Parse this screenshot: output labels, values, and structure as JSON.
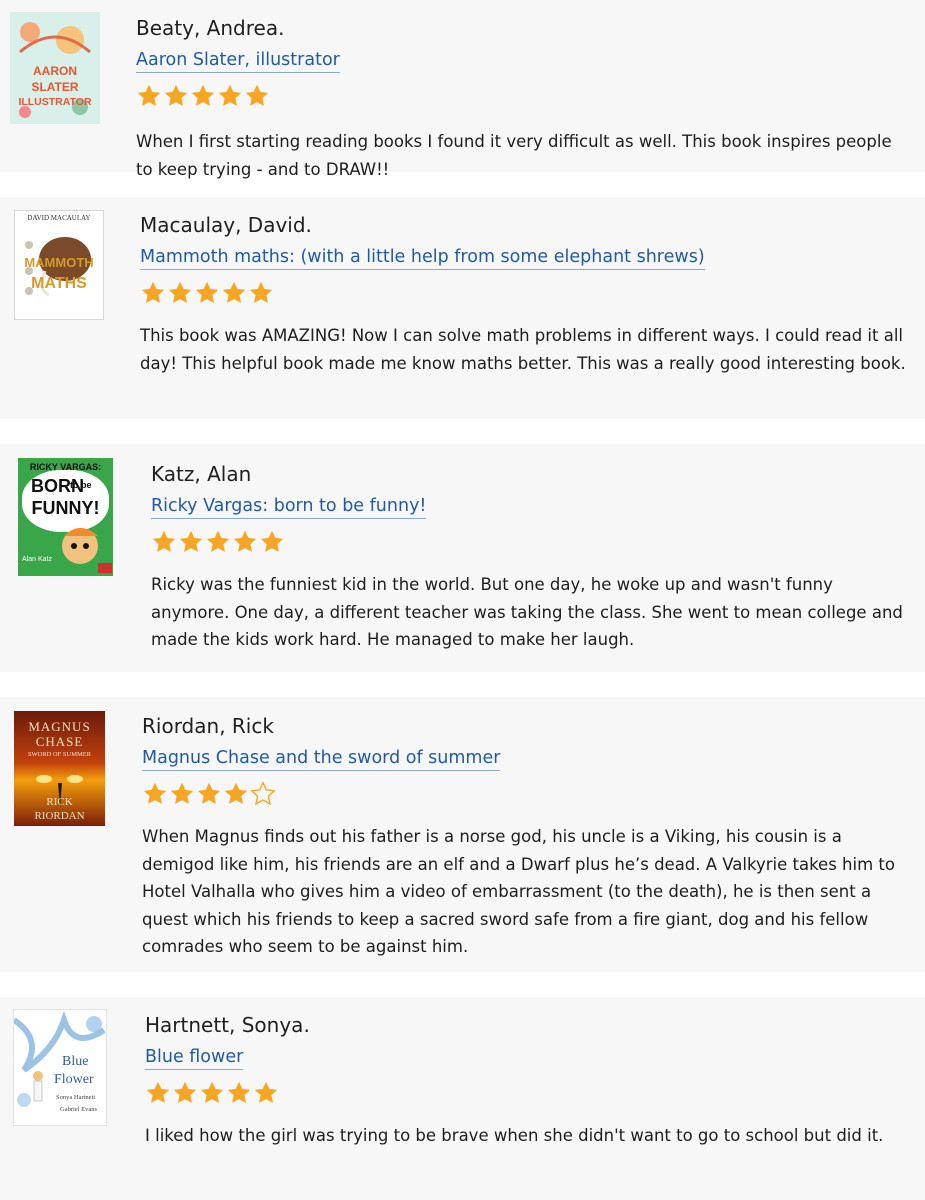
{
  "colors": {
    "star_fill": "#f6a623",
    "link": "#1f5aa6",
    "card_bg": "#f7f7f7"
  },
  "reviews": [
    {
      "author": "Beaty, Andrea.",
      "title": "Aaron Slater, illustrator",
      "rating": 5,
      "max_rating": 5,
      "text": "When I first starting reading books I found it very difficult as well. This book inspires people to keep trying - and to DRAW!!",
      "cover": {
        "lines": [
          "AARON",
          "SLATER",
          "ILLUSTRATOR"
        ]
      }
    },
    {
      "author": "Macaulay, David.",
      "title": "Mammoth maths: (with a little help from some elephant shrews)",
      "rating": 5,
      "max_rating": 5,
      "text": "This book was AMAZING! Now I can solve math problems in different ways. I could read it all day! This helpful book made me know maths better. This was a really good interesting book.",
      "cover": {
        "author_line": "DAVID MACAULAY",
        "lines": [
          "MAMMOTH",
          "MATHS"
        ]
      }
    },
    {
      "author": "Katz, Alan",
      "title": "Ricky Vargas: born to be funny!",
      "rating": 5,
      "max_rating": 5,
      "text": "Ricky was the funniest kid in the world. But one day, he woke up and wasn't funny anymore. One day, a different teacher was taking the class. She went to mean college and made the kids work hard. He managed to make her laugh.",
      "cover": {
        "lines": [
          "RICKY VARGAS:",
          "BORN",
          "to be",
          "FUNNY!"
        ],
        "author_line": "Alan Katz"
      }
    },
    {
      "author": "Riordan, Rick",
      "title": "Magnus Chase and the sword of summer",
      "rating": 4,
      "max_rating": 5,
      "text": "When Magnus finds out his father is a norse god, his uncle is a Viking, his cousin is a demigod like him, his friends are an elf and a Dwarf plus he’s dead. A Valkyrie takes him to Hotel Valhalla who gives him a video of embarrassment (to the death), he is then sent a quest which his friends to keep a sacred sword safe from a fire giant, dog and his fellow comrades who seem to be against him.",
      "cover": {
        "lines": [
          "MAGNUS",
          "CHASE",
          "SWORD OF SUMMER"
        ],
        "author_lines": [
          "RICK",
          "RIORDAN"
        ]
      }
    },
    {
      "author": "Hartnett, Sonya.",
      "title": "Blue flower",
      "rating": 5,
      "max_rating": 5,
      "text": "I liked how the girl was trying to be brave when she didn't want to go to school but did it.",
      "cover": {
        "lines": [
          "Blue",
          "Flower"
        ],
        "author_lines": [
          "Sonya Hartnett",
          "Gabriel Evans"
        ]
      }
    }
  ]
}
